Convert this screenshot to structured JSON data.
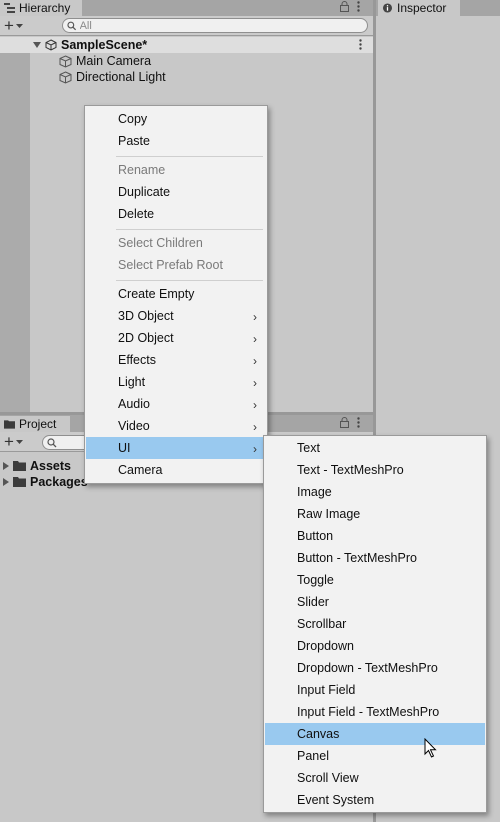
{
  "hierarchy": {
    "tab_label": "Hierarchy",
    "add_label": "+",
    "search_placeholder": "All",
    "scene_name": "SampleScene*",
    "objects": [
      "Main Camera",
      "Directional Light"
    ]
  },
  "inspector": {
    "tab_label": "Inspector"
  },
  "project": {
    "tab_label": "Project",
    "add_label": "+",
    "folders": [
      "Assets",
      "Packages"
    ]
  },
  "context_menu": {
    "items": [
      {
        "label": "Copy",
        "enabled": true
      },
      {
        "label": "Paste",
        "enabled": true
      },
      {
        "label": "Rename",
        "enabled": false
      },
      {
        "label": "Duplicate",
        "enabled": true
      },
      {
        "label": "Delete",
        "enabled": true
      },
      {
        "label": "Select Children",
        "enabled": false
      },
      {
        "label": "Select Prefab Root",
        "enabled": false
      },
      {
        "label": "Create Empty",
        "enabled": true
      },
      {
        "label": "3D Object",
        "enabled": true,
        "submenu": true
      },
      {
        "label": "2D Object",
        "enabled": true,
        "submenu": true
      },
      {
        "label": "Effects",
        "enabled": true,
        "submenu": true
      },
      {
        "label": "Light",
        "enabled": true,
        "submenu": true
      },
      {
        "label": "Audio",
        "enabled": true,
        "submenu": true
      },
      {
        "label": "Video",
        "enabled": true,
        "submenu": true
      },
      {
        "label": "UI",
        "enabled": true,
        "submenu": true,
        "highlighted": true
      },
      {
        "label": "Camera",
        "enabled": true
      }
    ]
  },
  "ui_submenu": {
    "items": [
      "Text",
      "Text - TextMeshPro",
      "Image",
      "Raw Image",
      "Button",
      "Button - TextMeshPro",
      "Toggle",
      "Slider",
      "Scrollbar",
      "Dropdown",
      "Dropdown - TextMeshPro",
      "Input Field",
      "Input Field - TextMeshPro",
      "Canvas",
      "Panel",
      "Scroll View",
      "Event System"
    ],
    "highlighted": "Canvas"
  },
  "colors": {
    "highlight": "#99c9ef",
    "panel": "#c8c8c8",
    "menu": "#f2f2f2"
  }
}
